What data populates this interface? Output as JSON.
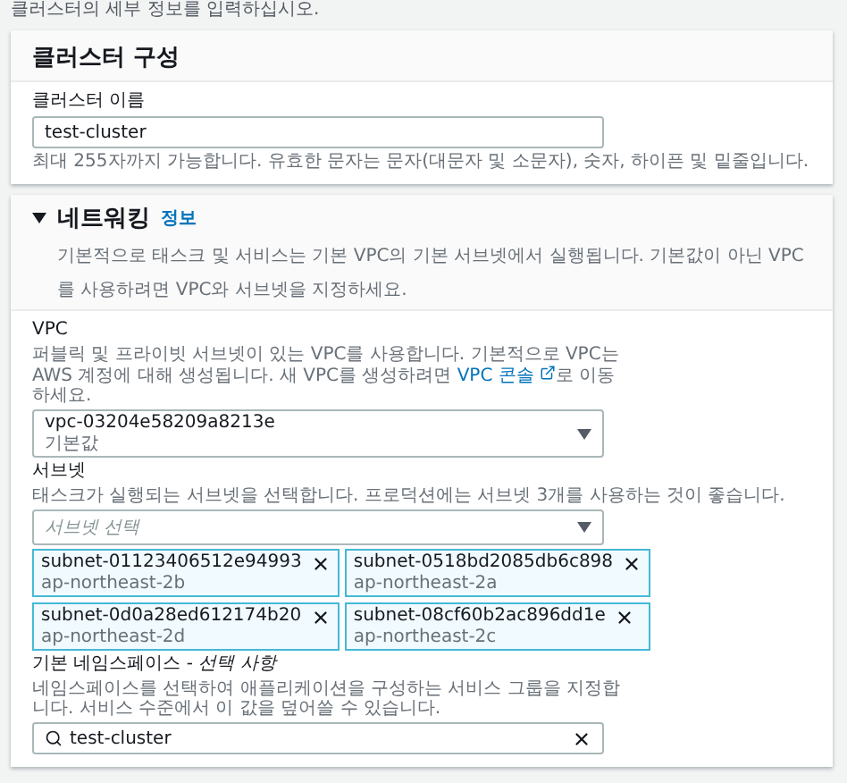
{
  "intro": "클러스터의 세부 정보를 입력하십시오.",
  "cluster_config": {
    "title": "클러스터 구성",
    "name_label": "클러스터 이름",
    "name_value": "test-cluster",
    "name_hint": "최대 255자까지 가능합니다. 유효한 문자는 문자(대문자 및 소문자), 숫자, 하이픈 및 밑줄입니다."
  },
  "networking": {
    "title": "네트워킹",
    "expanded": true,
    "info_link": "정보",
    "description": "기본적으로 태스크 및 서비스는 기본 VPC의 기본 서브넷에서 실행됩니다. 기본값이 아닌 VPC를 사용하려면 VPC와 서브넷을 지정하세요.",
    "vpc": {
      "label": "VPC",
      "description_before": "퍼블릭 및 프라이빗 서브넷이 있는 VPC를 사용합니다. 기본적으로 VPC는 AWS 계정에 대해 생성됩니다. 새 VPC를 생성하려면",
      "link": "VPC 콘솔",
      "description_after": "로 이동하세요.",
      "value": "vpc-03204e58209a8213e",
      "sublabel": "기본값"
    },
    "subnets": {
      "label": "서브넷",
      "description": "태스크가 실행되는 서브넷을 선택합니다. 프로덕션에는 서브넷 3개를 사용하는 것이 좋습니다.",
      "placeholder": "서브넷 선택",
      "tokens": [
        {
          "id": "subnet-01123406512e94993",
          "zone": "ap-northeast-2b"
        },
        {
          "id": "subnet-0518bd2085db6c898",
          "zone": "ap-northeast-2a"
        },
        {
          "id": "subnet-0d0a28ed612174b20",
          "zone": "ap-northeast-2d"
        },
        {
          "id": "subnet-08cf60b2ac896dd1e",
          "zone": "ap-northeast-2c"
        }
      ]
    },
    "namespace": {
      "label": "기본 네임스페이스 -",
      "optional": "선택 사항",
      "description": "네임스페이스를 선택하여 애플리케이션을 구성하는 서비스 그룹을 지정합니다. 서비스 수준에서 이 값을 덮어쓸 수 있습니다.",
      "value": "test-cluster"
    }
  }
}
